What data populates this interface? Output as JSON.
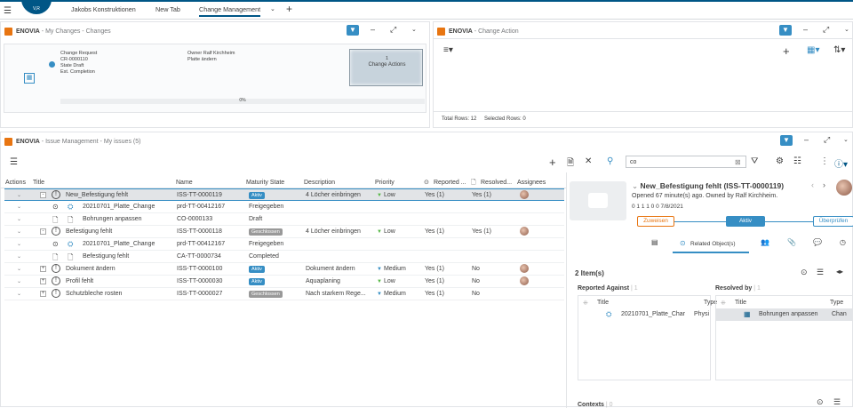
{
  "topbar": {
    "logo_text": "V,R",
    "tabs": [
      {
        "label": "Jakobs Konstruktionen"
      },
      {
        "label": "New Tab"
      },
      {
        "label": "Change Management"
      }
    ],
    "add_tab": "+"
  },
  "changes_panel": {
    "app": "ENOVIA",
    "title": " - My Changes - Changes",
    "fields": {
      "type": "Change Request",
      "id": "CR-0000110",
      "state": "State Draft",
      "est": "Est. Completion",
      "owner": "Owner Ralf Kirchheim",
      "platte": "Platte ändern"
    },
    "progress": "0%",
    "action_btn": {
      "count": "1",
      "label": "Change Actions"
    }
  },
  "action_panel": {
    "app": "ENOVIA",
    "title": " - Change Action",
    "total_rows": "Total Rows: 12",
    "selected_rows": "Selected Rows: 0"
  },
  "issues_panel": {
    "app": "ENOVIA",
    "title": " - Issue Management",
    "subtitle": " - My issues (5)",
    "search_value": "co",
    "columns": {
      "actions": "Actions",
      "title": "Title",
      "name": "Name",
      "maturity": "Maturity State",
      "desc": "Description",
      "priority": "Priority",
      "reported": "Reported ...",
      "resolved": "Resolved...",
      "assignees": "Assignees"
    },
    "rows": [
      {
        "title": "New_Befestigung fehlt",
        "name": "ISS-TT-0000119",
        "state": "Aktiv",
        "state_type": "aktiv",
        "desc": "4 Löcher einbringen",
        "priority": "Low",
        "reported": "Yes (1)",
        "resolved": "Yes (1)",
        "avatar": true,
        "level": 0,
        "kind": "issue",
        "sel": true,
        "toggle": "-"
      },
      {
        "title": "20210701_Platte_Change",
        "name": "prd-TT-00412167",
        "state": "Freigegeben",
        "state_type": "text",
        "level": 1,
        "kind": "part"
      },
      {
        "title": "Bohrungen anpassen",
        "name": "CO-0000133",
        "state": "Draft",
        "state_type": "text",
        "level": 1,
        "kind": "doc"
      },
      {
        "title": "Befestigung fehlt",
        "name": "ISS-TT-0000118",
        "state": "Geschlossen",
        "state_type": "gesch",
        "desc": "4 Löcher einbringen",
        "priority": "Low",
        "reported": "Yes (1)",
        "resolved": "Yes (1)",
        "avatar": true,
        "level": 0,
        "kind": "issue",
        "toggle": "-"
      },
      {
        "title": "20210701_Platte_Change",
        "name": "prd-TT-00412167",
        "state": "Freigegeben",
        "state_type": "text",
        "level": 1,
        "kind": "part"
      },
      {
        "title": "Befestigung fehlt",
        "name": "CA-TT-0000734",
        "state": "Completed",
        "state_type": "text",
        "level": 1,
        "kind": "doc"
      },
      {
        "title": "Dokument ändern",
        "name": "ISS-TT-0000100",
        "state": "Aktiv",
        "state_type": "aktiv",
        "desc": "Dokument ändern",
        "priority": "Medium",
        "reported": "Yes (1)",
        "resolved": "No",
        "avatar": true,
        "level": 0,
        "kind": "issue",
        "toggle": "+"
      },
      {
        "title": "Profil fehlt",
        "name": "ISS-TT-0000030",
        "state": "Aktiv",
        "state_type": "aktiv",
        "desc": "Aquaplaning",
        "priority": "Low",
        "reported": "Yes (1)",
        "resolved": "No",
        "avatar": true,
        "level": 0,
        "kind": "issue",
        "toggle": "+"
      },
      {
        "title": "Schutzbleche rosten",
        "name": "ISS-TT-0000027",
        "state": "Geschlossen",
        "state_type": "gesch",
        "desc": "Nach starkem Rege...",
        "priority": "Medium",
        "reported": "Yes (1)",
        "resolved": "No",
        "avatar": false,
        "level": 0,
        "kind": "issue",
        "toggle": "+"
      }
    ]
  },
  "detail": {
    "title": "New_Befestigung fehlt (ISS-TT-0000119)",
    "opened": "Opened 67 minute(s) ago. Owned by Ralf Kirchheim.",
    "counts": "0  1  1  1  0  0  7/8/2021",
    "lifecycle": {
      "prev": "Zuweisen",
      "current": "Aktiv",
      "next": "Überprüfen"
    },
    "tab_related": "Related Object(s)",
    "items": "2 Item(s)",
    "reported_against": "Reported Against",
    "reported_count": "1",
    "resolved_by": "Resolved by",
    "resolved_count": "1",
    "col_title": "Title",
    "col_type": "Type",
    "ra_title": "20210701_Platte_Char",
    "ra_type": "Physi",
    "rb_title": "Bohrungen anpassen",
    "rb_type": "Chan",
    "contexts": "Contexts",
    "contexts_count": "0"
  }
}
